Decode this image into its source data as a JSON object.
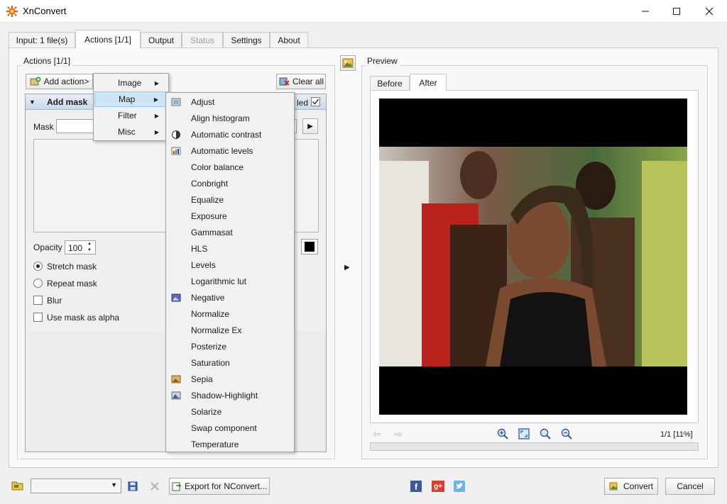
{
  "window": {
    "title": "XnConvert",
    "minimize_icon": "minimize-icon",
    "maximize_icon": "maximize-icon",
    "close_icon": "close-icon"
  },
  "tabs": [
    {
      "label": "Input: 1 file(s)"
    },
    {
      "label": "Actions [1/1]"
    },
    {
      "label": "Output"
    },
    {
      "label": "Status"
    },
    {
      "label": "Settings"
    },
    {
      "label": "About"
    }
  ],
  "actions": {
    "group_title": "Actions [1/1]",
    "add_action_label": "Add action>",
    "clear_all_label": "Clear all",
    "panel_title": "Add mask",
    "enabled_label": "led",
    "mask_label": "Mask",
    "opacity_label": "Opacity",
    "opacity_value": "100",
    "stretch_mask_label": "Stretch mask",
    "repeat_mask_label": "Repeat mask",
    "blur_label": "Blur",
    "use_mask_alpha_label": "Use mask as alpha",
    "mask_color": "#000000"
  },
  "menu": {
    "items": [
      "Image",
      "Map",
      "Filter",
      "Misc"
    ],
    "highlighted": "Map"
  },
  "submenu": {
    "items": [
      {
        "label": "Adjust",
        "icon": "adjust-icon"
      },
      {
        "label": "Align histogram",
        "icon": ""
      },
      {
        "label": "Automatic contrast",
        "icon": "contrast-icon"
      },
      {
        "label": "Automatic levels",
        "icon": "levels-icon"
      },
      {
        "label": "Color balance",
        "icon": ""
      },
      {
        "label": "Conbright",
        "icon": ""
      },
      {
        "label": "Equalize",
        "icon": ""
      },
      {
        "label": "Exposure",
        "icon": ""
      },
      {
        "label": "Gammasat",
        "icon": ""
      },
      {
        "label": "HLS",
        "icon": ""
      },
      {
        "label": "Levels",
        "icon": ""
      },
      {
        "label": "Logarithmic lut",
        "icon": ""
      },
      {
        "label": "Negative",
        "icon": "negative-icon"
      },
      {
        "label": "Normalize",
        "icon": ""
      },
      {
        "label": "Normalize Ex",
        "icon": ""
      },
      {
        "label": "Posterize",
        "icon": ""
      },
      {
        "label": "Saturation",
        "icon": ""
      },
      {
        "label": "Sepia",
        "icon": "sepia-icon"
      },
      {
        "label": "Shadow-Highlight",
        "icon": "shadow-highlight-icon"
      },
      {
        "label": "Solarize",
        "icon": ""
      },
      {
        "label": "Swap component",
        "icon": ""
      },
      {
        "label": "Temperature",
        "icon": ""
      }
    ]
  },
  "preview": {
    "group_title": "Preview",
    "before_tab": "Before",
    "after_tab": "After",
    "page_info": "1/1 [11%]"
  },
  "bottom": {
    "export_label": "Export for NConvert...",
    "convert_label": "Convert",
    "cancel_label": "Cancel"
  },
  "colors": {
    "accent": "#cce4f7",
    "panel_header": "#cdd9e8"
  }
}
